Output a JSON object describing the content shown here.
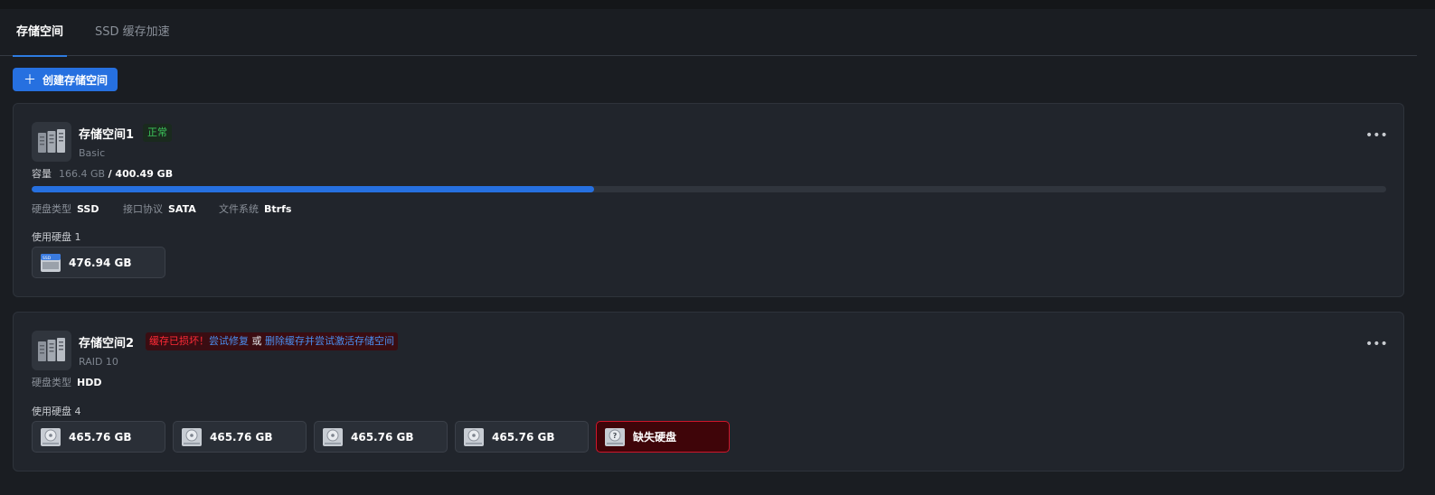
{
  "tabs": [
    {
      "label": "存储空间",
      "active": true
    },
    {
      "label": "SSD 缓存加速",
      "active": false
    }
  ],
  "create_button": {
    "icon": "plus-icon",
    "label": "创建存储空间"
  },
  "colors": {
    "accent": "#2670e0",
    "ok": "#3cc45a",
    "error": "#ff2a36",
    "link": "#4a8ff0"
  },
  "pools": [
    {
      "name": "存储空间1",
      "status": "正常",
      "raid": "Basic",
      "capacity": {
        "label": "容量",
        "used": "166.4 GB",
        "total": "/ 400.49 GB",
        "used_fraction": 0.4155
      },
      "meta": [
        {
          "key": "硬盘类型",
          "value": "SSD"
        },
        {
          "key": "接口协议",
          "value": "SATA"
        },
        {
          "key": "文件系统",
          "value": "Btrfs"
        }
      ],
      "disks_label": "使用硬盘 1",
      "disks": [
        {
          "size": "476.94 GB",
          "icon": "ssd-icon"
        }
      ]
    },
    {
      "name": "存储空间2",
      "status_error": {
        "message": "缓存已损坏！",
        "action1": "尝试修复",
        "or": "或",
        "action2": "删除缓存并尝试激活存储空间"
      },
      "raid": "RAID 10",
      "meta": [
        {
          "key": "硬盘类型",
          "value": "HDD"
        }
      ],
      "disks_label": "使用硬盘 4",
      "disks": [
        {
          "size": "465.76 GB",
          "icon": "hdd-icon"
        },
        {
          "size": "465.76 GB",
          "icon": "hdd-icon"
        },
        {
          "size": "465.76 GB",
          "icon": "hdd-icon"
        },
        {
          "size": "465.76 GB",
          "icon": "hdd-icon"
        },
        {
          "size": "缺失硬盘",
          "icon": "missing-disk-icon",
          "missing": true
        }
      ]
    }
  ]
}
